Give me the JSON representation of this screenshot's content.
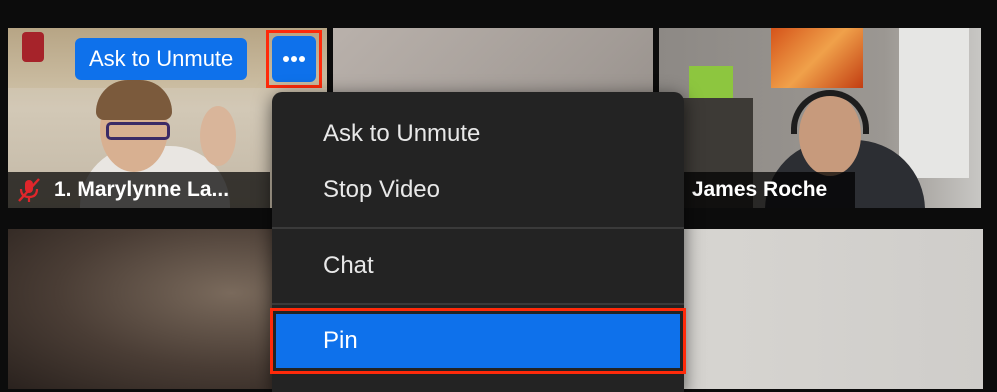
{
  "participants": [
    {
      "name": "1. Marylynne La...",
      "muted": true
    },
    {
      "name": ": James Roche"
    }
  ],
  "hover_controls": {
    "ask_to_unmute_label": "Ask to Unmute",
    "more_icon": "more-horizontal-icon"
  },
  "context_menu": {
    "items": [
      {
        "label": "Ask to Unmute"
      },
      {
        "label": "Stop Video"
      },
      {
        "label": "Chat"
      },
      {
        "label": "Pin",
        "highlighted": true
      }
    ]
  },
  "colors": {
    "accent": "#0e71eb",
    "highlight_outline": "#ff2a0a",
    "menu_bg": "#232323",
    "muted_icon": "#e0262b"
  }
}
